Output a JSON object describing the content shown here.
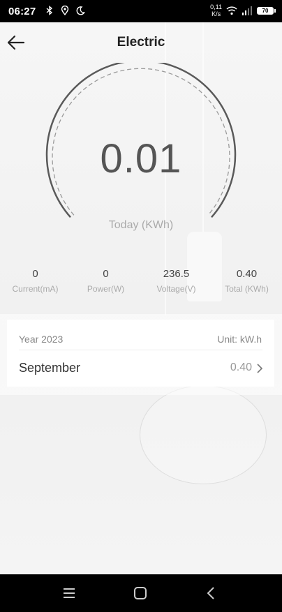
{
  "status": {
    "time": "06:27",
    "net_speed_value": "0,11",
    "net_speed_unit": "K/s",
    "battery": "70",
    "left_icons": [
      "bluetooth-icon",
      "location-icon",
      "moon-icon"
    ],
    "right_icons": [
      "wifi-icon",
      "signal-icon",
      "battery-icon"
    ]
  },
  "header": {
    "title": "Electric"
  },
  "gauge": {
    "value": "0.01",
    "label": "Today (KWh)"
  },
  "stats": [
    {
      "value": "0",
      "label": "Current(mA)"
    },
    {
      "value": "0",
      "label": "Power(W)"
    },
    {
      "value": "236.5",
      "label": "Voltage(V)"
    },
    {
      "value": "0.40",
      "label": "Total (KWh)"
    }
  ],
  "history": {
    "year": "Year 2023",
    "unit": "Unit: kW.h",
    "rows": [
      {
        "month": "September",
        "value": "0.40"
      }
    ]
  },
  "colors": {
    "statusbar": "#000000",
    "arc": "#555555",
    "muted_text": "#aaaaaa"
  }
}
